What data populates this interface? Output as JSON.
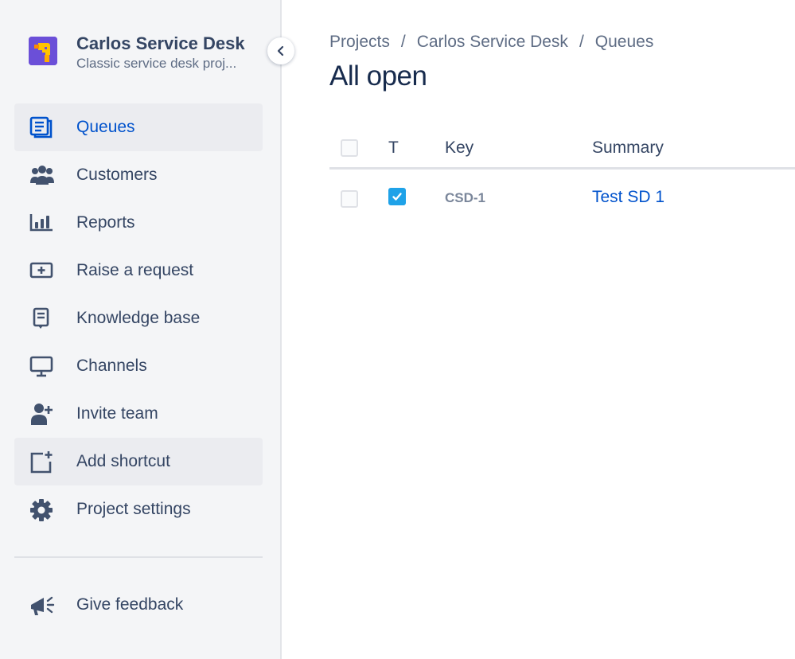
{
  "project": {
    "name": "Carlos Service Desk",
    "subtitle": "Classic service desk proj..."
  },
  "sidebar": {
    "items": [
      {
        "label": "Queues",
        "icon": "queues-icon",
        "selected": true
      },
      {
        "label": "Customers",
        "icon": "customers-icon"
      },
      {
        "label": "Reports",
        "icon": "reports-icon"
      },
      {
        "label": "Raise a request",
        "icon": "raise-request-icon"
      },
      {
        "label": "Knowledge base",
        "icon": "knowledge-base-icon"
      },
      {
        "label": "Channels",
        "icon": "channels-icon"
      },
      {
        "label": "Invite team",
        "icon": "invite-team-icon"
      },
      {
        "label": "Add shortcut",
        "icon": "add-shortcut-icon"
      },
      {
        "label": "Project settings",
        "icon": "gear-icon"
      }
    ],
    "feedback": {
      "label": "Give feedback",
      "icon": "megaphone-icon"
    }
  },
  "breadcrumb": [
    "Projects",
    "Carlos Service Desk",
    "Queues"
  ],
  "page": {
    "title": "All open"
  },
  "table": {
    "columns": [
      "T",
      "Key",
      "Summary"
    ],
    "rows": [
      {
        "type": "task",
        "key": "CSD-1",
        "summary": "Test SD 1"
      }
    ]
  },
  "colors": {
    "accent": "#0052cc",
    "sidebar_bg": "#f4f5f7",
    "text": "#344563",
    "type_icon": "#1fa2e8",
    "avatar": "#6b4fd8"
  }
}
